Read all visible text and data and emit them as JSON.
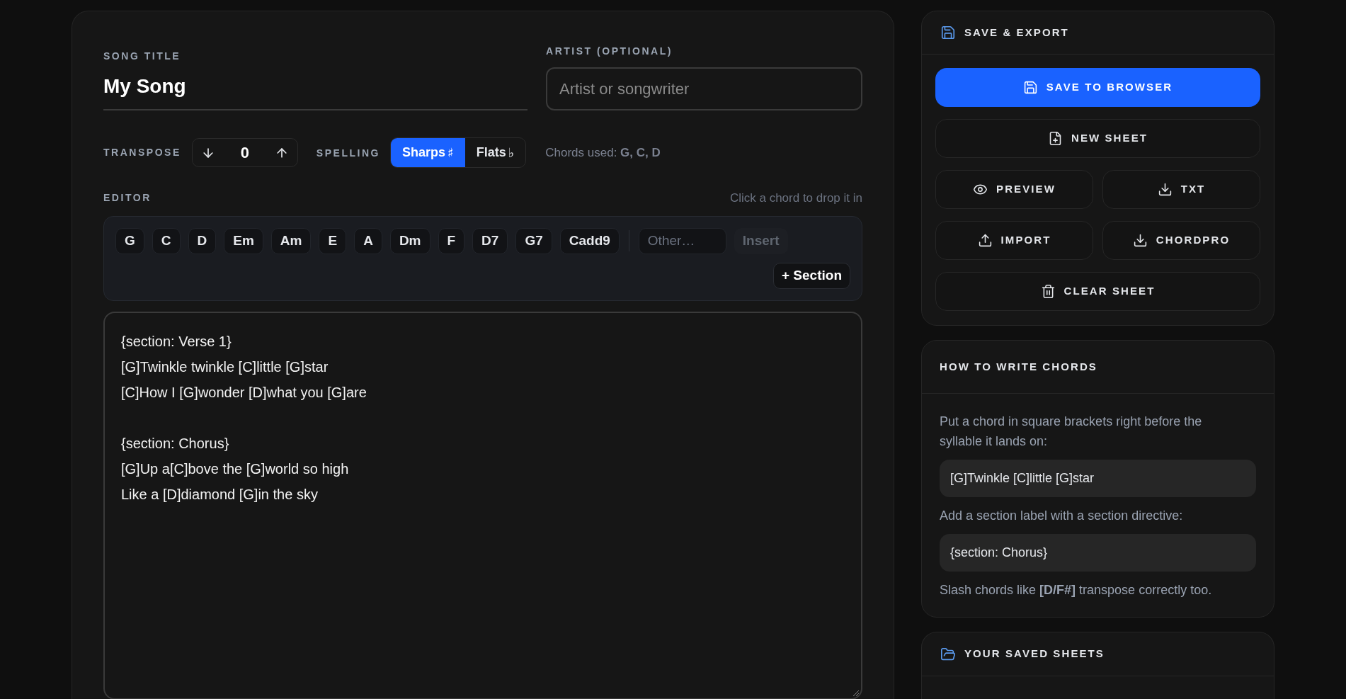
{
  "song_title": {
    "label": "SONG TITLE",
    "value": "My Song"
  },
  "artist": {
    "label": "ARTIST (OPTIONAL)",
    "placeholder": "Artist or songwriter"
  },
  "transpose": {
    "label": "TRANSPOSE",
    "value": "0"
  },
  "spelling": {
    "label": "SPELLING",
    "options": [
      {
        "label": "Sharps",
        "symbol": "♯",
        "selected": true
      },
      {
        "label": "Flats",
        "symbol": "♭",
        "selected": false
      }
    ]
  },
  "chords_used": "Chords used: **G, C, D**",
  "editor": {
    "label": "EDITOR",
    "hint": "Click a chord to drop it in",
    "chords": [
      "G",
      "C",
      "D",
      "Em",
      "Am",
      "E",
      "A",
      "Dm",
      "F",
      "D7",
      "G7",
      "Cadd9"
    ],
    "other_chord": {
      "placeholder": "Other…"
    },
    "insert": {
      "label": "Insert",
      "disabled": true
    },
    "section_button": "+ Section",
    "lyrics": [
      [
        "{section: Verse 1}",
        "[G]Twinkle twinkle [C]little [G]star",
        "[C]How I [G]wonder [D]what you [G]are"
      ],
      [
        "{section: Chorus}",
        "[G]Up a[C]bove the [G]world so high",
        "Like a [D]diamond [G]in the sky"
      ]
    ]
  },
  "save_export": {
    "title": "SAVE & EXPORT",
    "buttons": [
      {
        "kind": "primary",
        "label": "SAVE TO BROWSER"
      },
      {
        "kind": "wide",
        "label": "NEW SHEET"
      },
      {
        "kind": "half",
        "label": "PREVIEW"
      },
      {
        "kind": "half",
        "label": "TXT"
      },
      {
        "kind": "half",
        "label": "IMPORT"
      },
      {
        "kind": "half",
        "label": "CHORDPRO"
      },
      {
        "kind": "wide",
        "label": "CLEAR SHEET"
      }
    ]
  },
  "how_to": {
    "title": "HOW TO WRITE CHORDS",
    "items": [
      {
        "kind": "text",
        "text": "Put a chord in square brackets right before the syllable it lands on:"
      },
      {
        "kind": "code",
        "text": "[G]Twinkle [C]little [G]star"
      },
      {
        "kind": "text",
        "text": "Add a section label with a section directive:"
      },
      {
        "kind": "code",
        "text": "{section: Chorus}"
      },
      {
        "kind": "text",
        "text": "Slash chords like **[D/F#]** transpose correctly too."
      }
    ]
  },
  "saved_sheets": {
    "title": "YOUR SAVED SHEETS"
  }
}
